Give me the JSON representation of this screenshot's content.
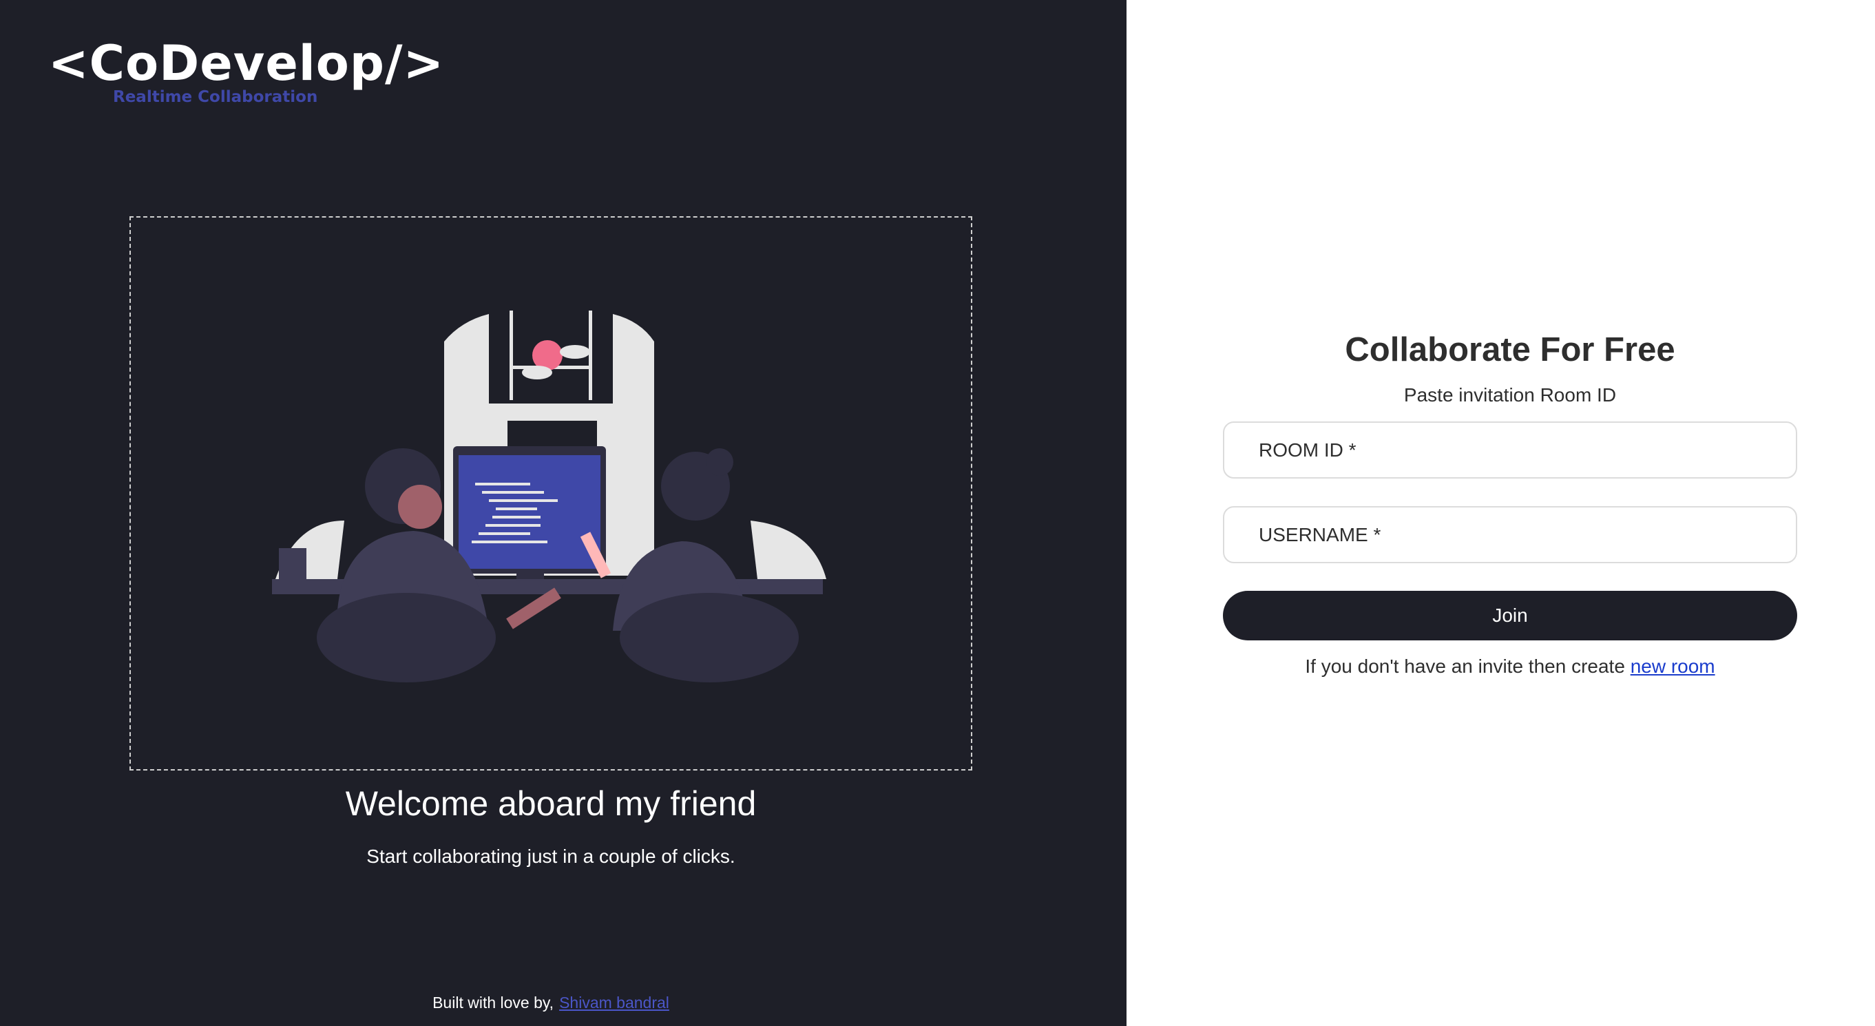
{
  "brand": {
    "name": "<CoDevelop/>",
    "tagline": "Realtime Collaboration"
  },
  "hero": {
    "title": "Welcome aboard my friend",
    "subtitle": "Start collaborating just in a couple of clicks."
  },
  "footer": {
    "text": "Built with love by,",
    "author_link": "Shivam bandral"
  },
  "form": {
    "title": "Collaborate For Free",
    "subtitle": "Paste invitation Room ID",
    "room_id_placeholder": "ROOM ID *",
    "username_placeholder": "USERNAME *",
    "join_label": "Join",
    "hint_text": "If you don't have an invite then create",
    "hint_link": "new room"
  },
  "colors": {
    "panel": "#1e1f28",
    "accent": "#3f48a8",
    "link": "#1a3ccc"
  }
}
